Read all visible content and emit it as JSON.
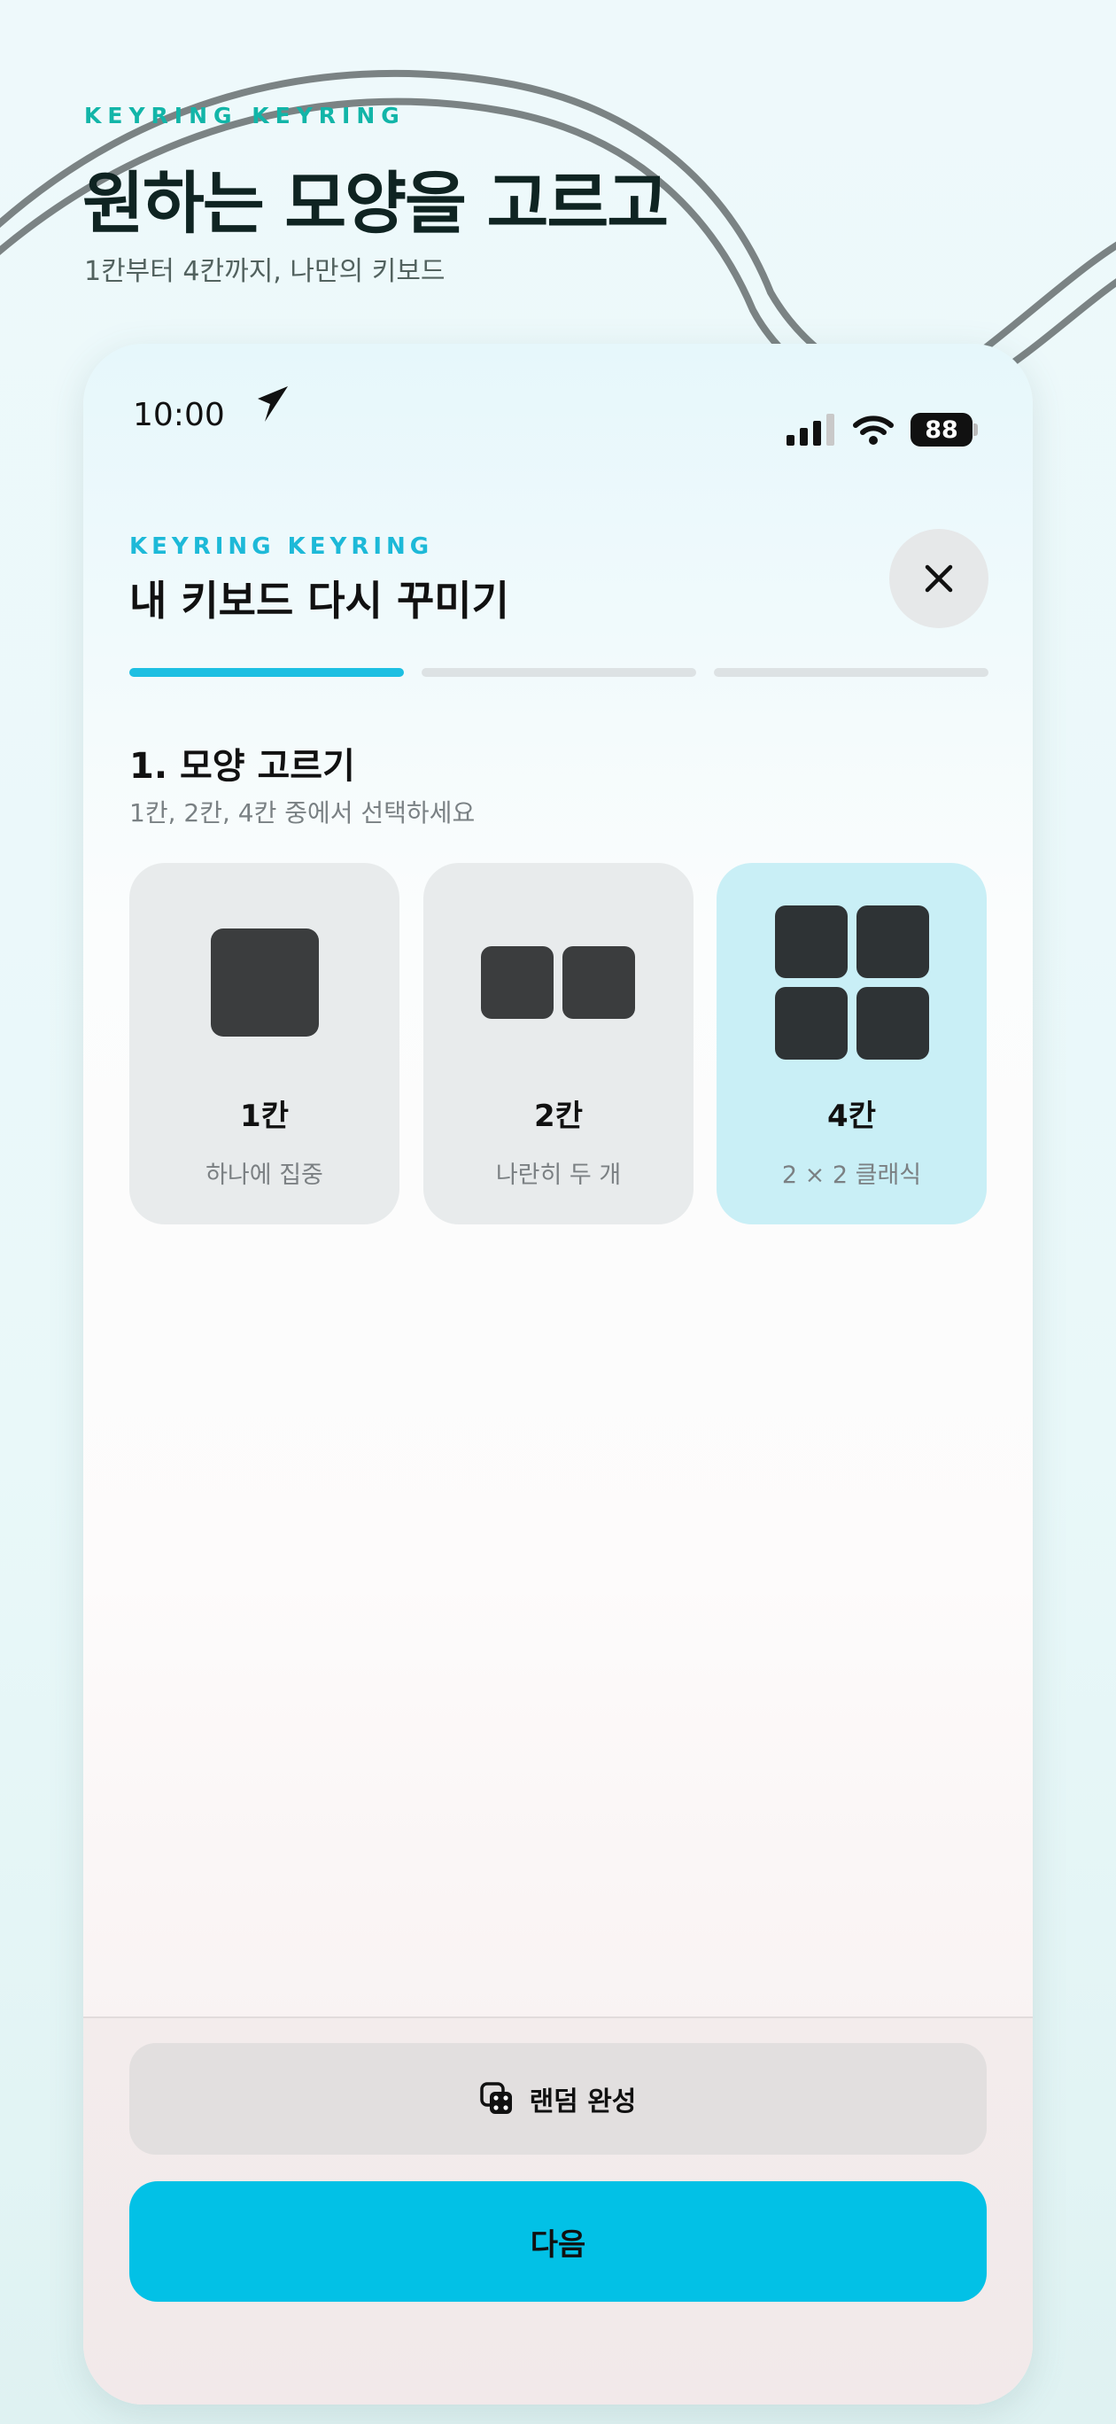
{
  "promo": {
    "eyebrow": "KEYRING KEYRING",
    "title": "원하는 모양을 고르고",
    "subtitle": "1칸부터 4칸까지, 나만의 키보드"
  },
  "status_bar": {
    "time": "10:00",
    "battery": "88"
  },
  "sheet": {
    "eyebrow": "KEYRING KEYRING",
    "title": "내 키보드 다시 꾸미기",
    "progress_step": 1,
    "progress_total": 3
  },
  "step": {
    "title": "1. 모양 고르기",
    "subtitle": "1칸, 2칸, 4칸 중에서 선택하세요"
  },
  "options": [
    {
      "label": "1칸",
      "desc": "하나에 집중",
      "selected": false
    },
    {
      "label": "2칸",
      "desc": "나란히 두 개",
      "selected": false
    },
    {
      "label": "4칸",
      "desc": "2 × 2 클래식",
      "selected": true
    }
  ],
  "buttons": {
    "random_label": "랜덤 완성",
    "next_label": "다음"
  },
  "colors": {
    "accent": "#02c1e6",
    "eyebrow_promo": "#12b5a8",
    "selected_card": "#c9eff6"
  },
  "icons": {
    "close": "close-icon",
    "random": "dice-icon",
    "location": "location-arrow-icon"
  }
}
